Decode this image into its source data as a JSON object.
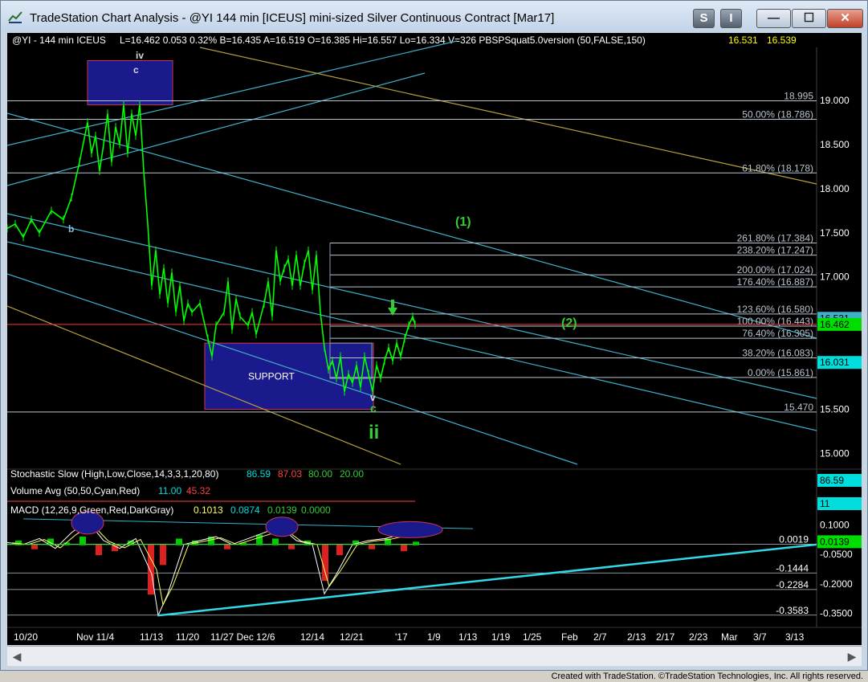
{
  "window": {
    "title": "TradeStation Chart Analysis - @YI 144 min [ICEUS] mini-sized Silver Continuous Contract [Mar17]",
    "buttons": {
      "s": "S",
      "i": "I",
      "minimize": "—",
      "maximize": "☐",
      "close": "✕"
    }
  },
  "footer": "Created with TradeStation. ©TradeStation Technologies, Inc. All rights reserved.",
  "colors": {
    "background": "#000000",
    "price_bars": "#00ff00",
    "support_box": "#1a1a8c",
    "fib_line": "#b9c4cf",
    "channel_cyan": "#3fb0c8",
    "channel_yellow": "#b8a23c",
    "macd_line": "#ffffff",
    "macd_signal": "#ffff66",
    "wave_label": "#33cc33",
    "last_price_bg": "#00dd00",
    "last_value_bg": "#00dddd"
  },
  "header": {
    "symbol": "@YI - 144 min  ICEUS",
    "stats": "L=16.462  0.053   0.32%   B=16.435  A=16.519  O=16.385  Hi=16.557  Lo=16.334  V=326  PBSPSquat5.0version (50,FALSE,150)",
    "val1": "16.531",
    "val2": "16.539"
  },
  "chart_data": {
    "type": "candlestick",
    "symbol": "@YI",
    "interval": "144 min",
    "y_axis": {
      "range": [
        14.85,
        19.6
      ],
      "ticks": [
        "19.000",
        "18.500",
        "18.000",
        "17.500",
        "17.000",
        "16.500",
        "16.000",
        "15.500",
        "15.000"
      ]
    },
    "x_axis_labels": [
      "10/20",
      "Nov 11/4",
      "11/13",
      "11/20",
      "11/27 Dec 12/6",
      "12/14",
      "12/21",
      "'17",
      "1/9",
      "1/13",
      "1/19",
      "1/25",
      "Feb",
      "2/7",
      "2/13",
      "2/17",
      "2/23",
      "Mar",
      "3/7",
      "3/13"
    ],
    "price_path": [
      [
        0,
        17.55
      ],
      [
        10,
        17.6
      ],
      [
        20,
        17.45
      ],
      [
        30,
        17.65
      ],
      [
        40,
        17.5
      ],
      [
        55,
        17.75
      ],
      [
        70,
        17.65
      ],
      [
        80,
        17.9
      ],
      [
        90,
        18.3
      ],
      [
        100,
        18.75
      ],
      [
        105,
        18.4
      ],
      [
        110,
        18.6
      ],
      [
        115,
        18.2
      ],
      [
        120,
        18.5
      ],
      [
        125,
        18.85
      ],
      [
        130,
        18.3
      ],
      [
        135,
        18.7
      ],
      [
        140,
        18.5
      ],
      [
        145,
        18.95
      ],
      [
        150,
        18.4
      ],
      [
        155,
        18.85
      ],
      [
        160,
        18.6
      ],
      [
        165,
        18.95
      ],
      [
        170,
        18.2
      ],
      [
        175,
        17.6
      ],
      [
        180,
        16.9
      ],
      [
        185,
        17.3
      ],
      [
        190,
        16.8
      ],
      [
        195,
        17.1
      ],
      [
        200,
        16.7
      ],
      [
        205,
        17.05
      ],
      [
        210,
        16.6
      ],
      [
        215,
        16.9
      ],
      [
        220,
        16.5
      ],
      [
        225,
        16.7
      ],
      [
        230,
        16.6
      ],
      [
        240,
        16.7
      ],
      [
        250,
        16.3
      ],
      [
        255,
        16.1
      ],
      [
        260,
        16.45
      ],
      [
        270,
        16.6
      ],
      [
        275,
        16.95
      ],
      [
        280,
        16.4
      ],
      [
        285,
        16.75
      ],
      [
        290,
        16.55
      ],
      [
        300,
        16.45
      ],
      [
        305,
        16.6
      ],
      [
        310,
        16.35
      ],
      [
        320,
        16.7
      ],
      [
        325,
        16.95
      ],
      [
        330,
        16.55
      ],
      [
        335,
        17.3
      ],
      [
        340,
        16.95
      ],
      [
        345,
        17.1
      ],
      [
        350,
        17.2
      ],
      [
        355,
        16.9
      ],
      [
        360,
        17.25
      ],
      [
        365,
        16.9
      ],
      [
        370,
        17.15
      ],
      [
        375,
        17.3
      ],
      [
        380,
        16.85
      ],
      [
        385,
        17.25
      ],
      [
        390,
        16.6
      ],
      [
        395,
        16.2
      ],
      [
        400,
        15.95
      ],
      [
        405,
        16.05
      ],
      [
        410,
        15.85
      ],
      [
        415,
        16.1
      ],
      [
        420,
        15.7
      ],
      [
        425,
        15.9
      ],
      [
        430,
        15.8
      ],
      [
        435,
        16.0
      ],
      [
        440,
        15.75
      ],
      [
        445,
        16.1
      ],
      [
        450,
        15.9
      ],
      [
        455,
        15.7
      ],
      [
        460,
        16.0
      ],
      [
        465,
        15.85
      ],
      [
        470,
        16.05
      ],
      [
        475,
        16.2
      ],
      [
        480,
        16.05
      ],
      [
        485,
        16.25
      ],
      [
        490,
        16.1
      ],
      [
        495,
        16.3
      ],
      [
        500,
        16.45
      ],
      [
        505,
        16.55
      ],
      [
        508,
        16.46
      ]
    ],
    "support_zone": {
      "label": "SUPPORT",
      "y": [
        15.5,
        16.25
      ]
    },
    "upper_box": {
      "y": [
        18.95,
        19.45
      ]
    },
    "fib_levels": [
      {
        "label": "18.995",
        "value": 18.995
      },
      {
        "label": "50.00% (18.786)",
        "value": 18.786
      },
      {
        "label": "61.80% (18.178)",
        "value": 18.178
      },
      {
        "label": "261.80% (17.384)",
        "value": 17.384
      },
      {
        "label": "238.20% (17.247)",
        "value": 17.247
      },
      {
        "label": "200.00% (17.024)",
        "value": 17.024
      },
      {
        "label": "176.40% (16.887)",
        "value": 16.887
      },
      {
        "label": "123.60% (16.580)",
        "value": 16.58
      },
      {
        "label": "100.00% (16.443)",
        "value": 16.443
      },
      {
        "label": "76.40% (16.305)",
        "value": 16.305
      },
      {
        "label": "38.20% (16.083)",
        "value": 16.083
      },
      {
        "label": "0.00% (15.861)",
        "value": 15.861
      },
      {
        "label": "15.470",
        "value": 15.47
      }
    ],
    "wave_labels": [
      {
        "text": "(1)",
        "color": "#33cc33"
      },
      {
        "text": "(2)",
        "color": "#33cc33"
      },
      {
        "text": "ii",
        "color": "#33cc33"
      },
      {
        "text": "c",
        "color": "#33cc33"
      },
      {
        "text": "iv",
        "color": "#cfd8e0"
      },
      {
        "text": "c",
        "color": "#cfd8e0"
      },
      {
        "text": "b",
        "color": "#8fb8e0"
      },
      {
        "text": "v",
        "color": "#cfd8e0"
      }
    ],
    "price_tags": [
      "16.531",
      "16.462",
      "16.031"
    ],
    "stochastic": {
      "label": "Stochastic Slow (High,Low,Close,14,3,3,1,20,80)",
      "values": [
        "86.59",
        "87.03",
        "80.00",
        "20.00"
      ],
      "tag": "86.59"
    },
    "volume_avg": {
      "label": "Volume Avg (50,50,Cyan,Red)",
      "values": [
        "11.00",
        "45.32"
      ],
      "tag": "11"
    },
    "macd": {
      "label": "MACD (12,26,9,Green,Red,DarkGray)",
      "values": [
        "0.1013",
        "0.0874",
        "0.0139",
        "0.0000"
      ],
      "y_ticks": [
        "0.1000",
        "-0.0500",
        "-0.2000",
        "-0.3500"
      ],
      "levels": [
        "0.0019",
        "-0.1444",
        "-0.2284",
        "-0.3583"
      ],
      "tag": "0.0139"
    }
  }
}
